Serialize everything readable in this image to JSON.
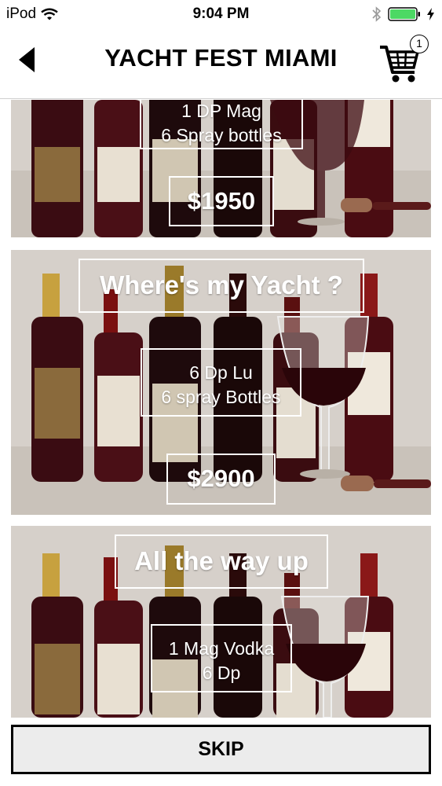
{
  "status": {
    "carrier": "iPod",
    "time": "9:04 PM"
  },
  "header": {
    "title": "YACHT FEST MIAMI",
    "cart_count": "1"
  },
  "packages": [
    {
      "title": "",
      "items_line1": "1 DP Mag",
      "items_line2": "6 Spray bottles",
      "price": "$1950"
    },
    {
      "title": "Where's my Yacht ?",
      "items_line1": "6 Dp Lu",
      "items_line2": "6 spray Bottles",
      "price": "$2900"
    },
    {
      "title": "All the way up",
      "items_line1": "1 Mag Vodka",
      "items_line2": "6 Dp",
      "price": ""
    }
  ],
  "skip_label": "SKIP",
  "colors": {
    "battery": "#4cd964",
    "card_background": "#d8d2cc",
    "wine_red": "#3a0a10"
  },
  "icons": [
    "wifi-icon",
    "bluetooth-icon",
    "battery-icon",
    "charging-icon",
    "back-arrow-icon",
    "cart-icon"
  ]
}
